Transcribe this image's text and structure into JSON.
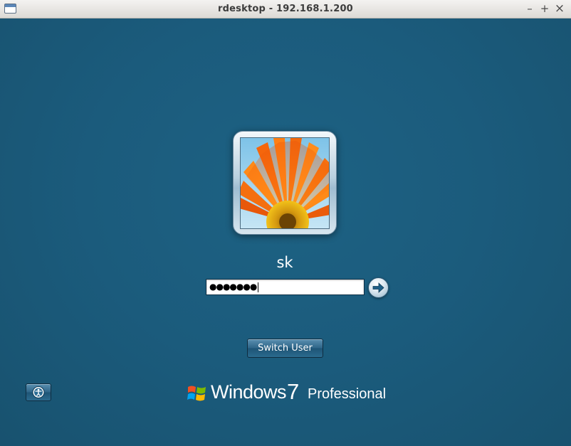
{
  "window": {
    "title": "rdesktop - 192.168.1.200",
    "controls": {
      "minimize": "–",
      "maximize": "+",
      "close": "×"
    }
  },
  "login": {
    "avatar_icon": "flower-avatar",
    "username": "sk",
    "password_masked": "●●●●●●●",
    "submit_icon": "arrow-right-icon",
    "switch_user_label": "Switch User",
    "ease_of_access_icon": "ease-of-access-icon"
  },
  "branding": {
    "logo_icon": "windows-flag-icon",
    "product": "Windows",
    "version": "7",
    "edition": "Professional"
  },
  "colors": {
    "desktop_bg": "#1b5a7a",
    "button_blue": "#2f6689",
    "flower_orange": "#f26b0f"
  }
}
